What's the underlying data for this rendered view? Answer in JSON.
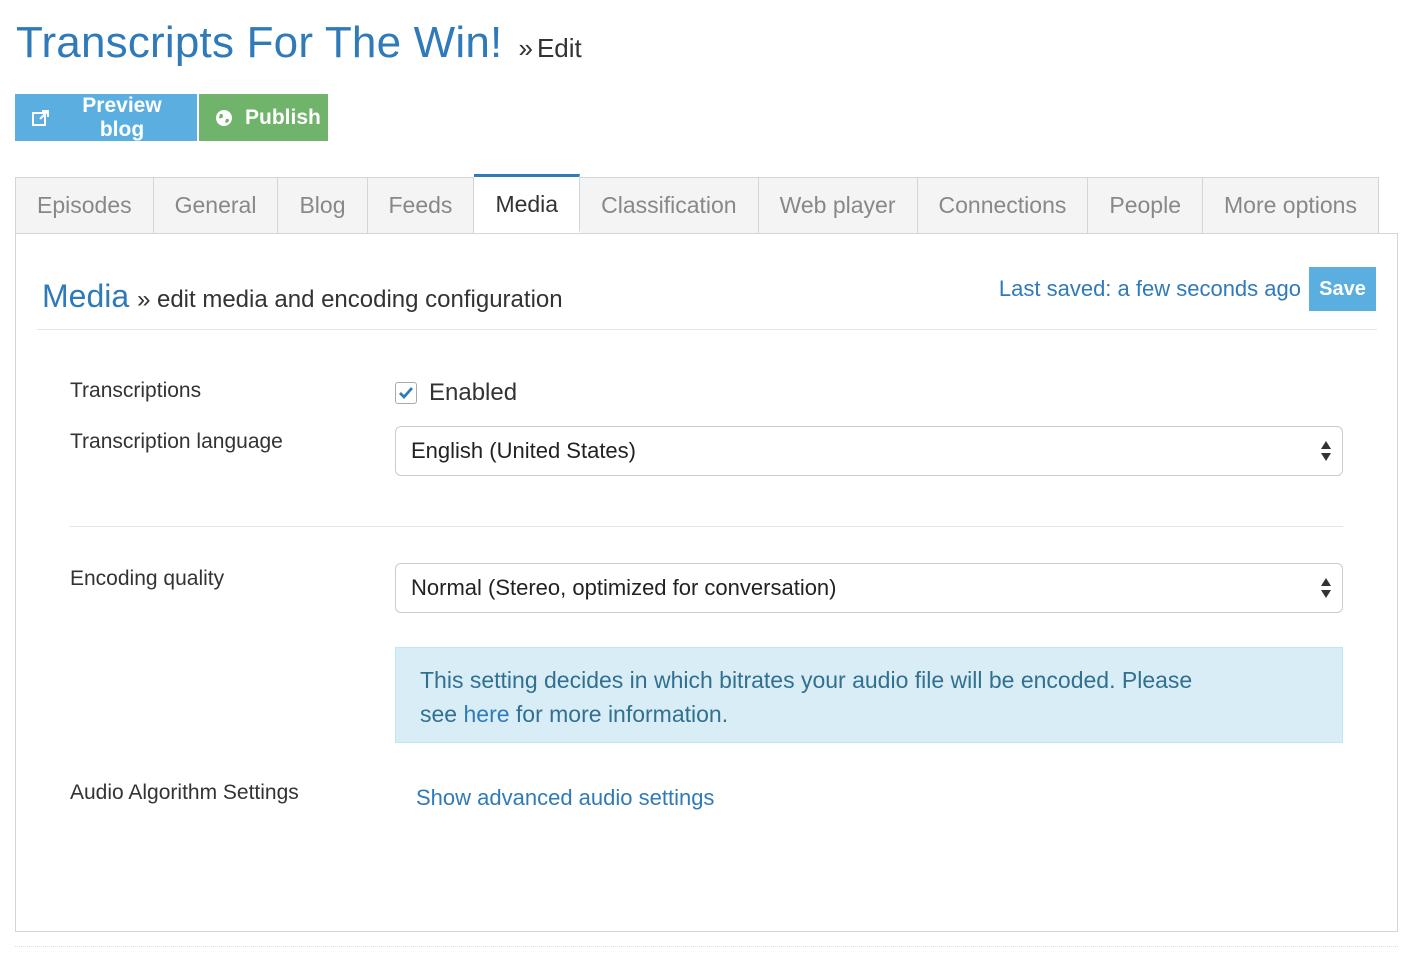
{
  "header": {
    "title": "Transcripts For The Win!",
    "separator": "»",
    "crumb": "Edit"
  },
  "actions": {
    "preview_label": "Preview blog",
    "preview_icon": "external-link-icon",
    "publish_label": "Publish",
    "publish_icon": "globe-icon"
  },
  "tabs": [
    {
      "label": "Episodes"
    },
    {
      "label": "General"
    },
    {
      "label": "Blog"
    },
    {
      "label": "Feeds"
    },
    {
      "label": "Media",
      "active": true
    },
    {
      "label": "Classification"
    },
    {
      "label": "Web player"
    },
    {
      "label": "Connections"
    },
    {
      "label": "People"
    },
    {
      "label": "More options"
    }
  ],
  "section": {
    "name": "Media",
    "separator": "»",
    "description": "edit media and encoding configuration"
  },
  "status": {
    "last_saved": "Last saved: a few seconds ago",
    "save_label": "Save"
  },
  "form": {
    "transcriptions_label": "Transcriptions",
    "transcriptions_checkbox_label": "Enabled",
    "transcriptions_checked": true,
    "language_label": "Transcription language",
    "language_value": "English (United States)",
    "encoding_label": "Encoding quality",
    "encoding_value": "Normal (Stereo, optimized for conversation)",
    "info_text_1": "This setting decides in which bitrates your audio file will be encoded. Please",
    "info_text_2a": "see",
    "info_link": "here",
    "info_text_2b": "for more information.",
    "audio_label": "Audio Algorithm Settings",
    "audio_link": "Show advanced audio settings"
  },
  "colors": {
    "brand_blue": "#2f7ab9",
    "button_blue": "#5aaee0",
    "publish_green": "#70b36a",
    "info_bg": "#d9edf7"
  }
}
